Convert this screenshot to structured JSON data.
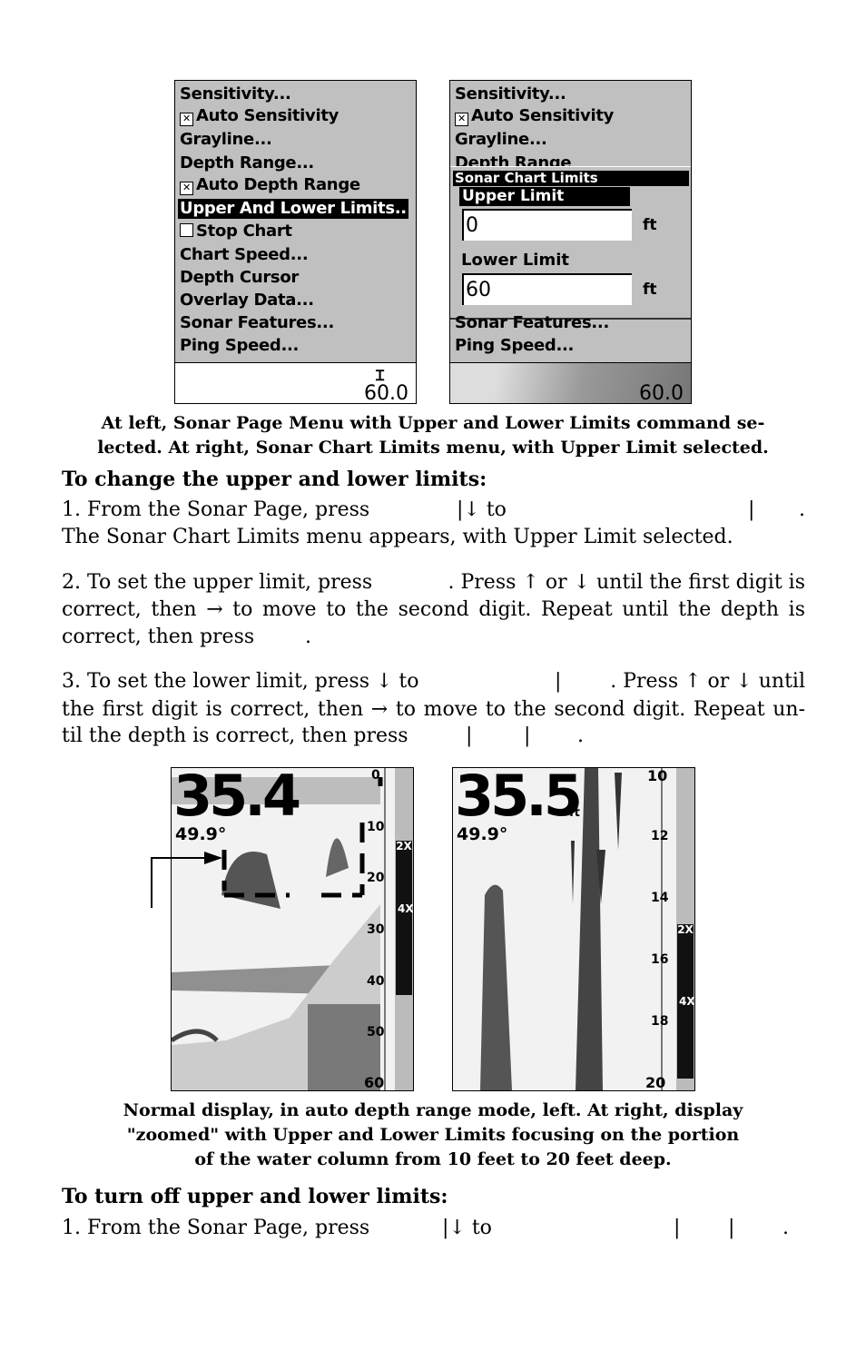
{
  "menu_left": {
    "items": [
      "Sensitivity...",
      "Auto Sensitivity",
      "Grayline...",
      "Depth Range...",
      "Auto Depth Range",
      "Upper And Lower Limits..",
      "Stop Chart",
      "Chart Speed...",
      "Depth Cursor",
      "Overlay Data...",
      "Sonar Features...",
      "Ping Speed..."
    ],
    "depth": "60.0"
  },
  "menu_right": {
    "items": [
      "Sensitivity...",
      "Auto Sensitivity",
      "Grayline...",
      "Depth Range",
      "Sonar Features...",
      "Ping Speed..."
    ],
    "dialog_title": "Sonar Chart Limits",
    "upper_label": "Upper Limit",
    "upper_value": "0",
    "lower_label": "Lower Limit",
    "lower_value": "60",
    "unit": "ft",
    "depth": "60.0"
  },
  "caption1": "At left, Sonar Page Menu with Upper and Lower Limits command selected. At right, Sonar Chart Limits menu, with Upper Limit selected.",
  "caption1_lines": [
    "At left, Sonar Page Menu with Upper and Lower Limits command se-",
    "lected. At right, Sonar Chart Limits menu, with Upper Limit selected."
  ],
  "heading1": "To change the upper and lower limits:",
  "step1": {
    "a": "1. From the Sonar Page, press",
    "b": "|↓ to",
    "c": "|",
    "d": ".",
    "line2": "The Sonar Chart Limits menu appears, with Upper Limit selected."
  },
  "step2": {
    "a": "2. To set the upper limit, press",
    "b": ". Press ↑ or ↓ until the first digit is",
    "line2": "correct, then → to move to the second digit. Repeat until the depth is",
    "line3a": "correct, then press",
    "line3b": "."
  },
  "step3": {
    "a": "3. To set the lower limit, press ↓ to",
    "b": "|",
    "c": ". Press ↑ or ↓ until",
    "line2": "the first digit is correct, then → to move to the second digit. Repeat un-",
    "line3a": "til the depth is correct, then press",
    "line3b": "|",
    "line3c": "|",
    "line3d": "."
  },
  "sonar_left": {
    "depth": "35.4",
    "temp": "49.9°",
    "scale": [
      "0",
      "10",
      "20",
      "30",
      "40",
      "50",
      "60"
    ],
    "zoom": [
      "2X",
      "4X"
    ]
  },
  "sonar_right": {
    "depth": "35.5",
    "unit": "ft",
    "temp": "49.9°",
    "scale": [
      "10",
      "12",
      "14",
      "16",
      "18",
      "20"
    ],
    "zoom": [
      "2X",
      "4X"
    ]
  },
  "caption2_lines": [
    "Normal display, in auto depth range mode, left. At right, display",
    "\"zoomed\" with Upper and Lower Limits focusing on the portion",
    "of the water column from 10 feet to 20 feet deep."
  ],
  "heading2": "To turn off upper and lower limits:",
  "step_off": {
    "a": "1. From the Sonar Page, press",
    "b": "|↓ to",
    "c": "|",
    "d": "|",
    "e": "."
  }
}
